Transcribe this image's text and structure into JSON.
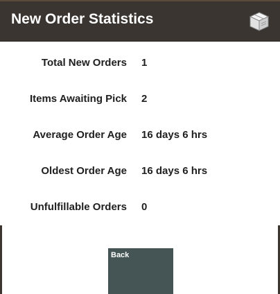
{
  "header": {
    "title": "New Order Statistics",
    "icon": "box-icon",
    "background": "#3a3530"
  },
  "stats": [
    {
      "label": "Total New Orders",
      "value": "1"
    },
    {
      "label": "Items Awaiting Pick",
      "value": "2"
    },
    {
      "label": "Average Order Age",
      "value": "16 days 6 hrs"
    },
    {
      "label": "Oldest Order Age",
      "value": "16 days 6 hrs"
    },
    {
      "label": "Unfulfillable Orders",
      "value": "0"
    }
  ],
  "actions": {
    "back_label": "Back",
    "back_color": "#455454"
  }
}
